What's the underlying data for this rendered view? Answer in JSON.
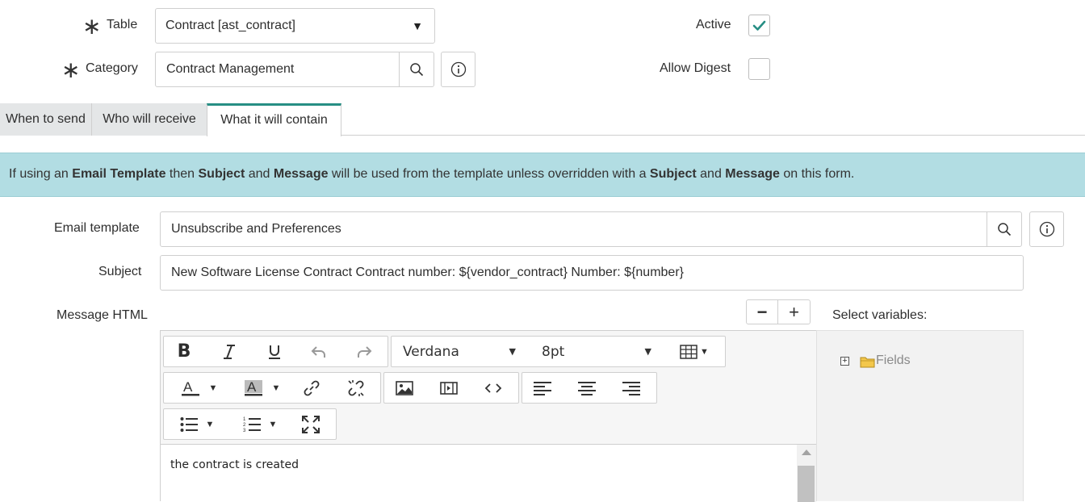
{
  "form": {
    "table": {
      "label": "Table",
      "value": "Contract [ast_contract]",
      "required_mark": "∗"
    },
    "category": {
      "label": "Category",
      "value": "Contract Management",
      "required_mark": "∗"
    },
    "active": {
      "label": "Active",
      "checked": true
    },
    "allow_digest": {
      "label": "Allow Digest",
      "checked": false
    }
  },
  "tabs": [
    {
      "label": "When to send",
      "active": false
    },
    {
      "label": "Who will receive",
      "active": false
    },
    {
      "label": "What it will contain",
      "active": true
    }
  ],
  "banner": {
    "parts": [
      "If using an ",
      "Email Template",
      " then ",
      "Subject",
      " and ",
      "Message",
      " will be used from the template unless overridden with a ",
      "Subject",
      " and ",
      "Message",
      " on this form."
    ]
  },
  "email_template": {
    "label": "Email template",
    "value": "Unsubscribe and Preferences"
  },
  "subject": {
    "label": "Subject",
    "value": "New Software License Contract Contract number: ${vendor_contract} Number: ${number}"
  },
  "message_html": {
    "label": "Message HTML",
    "zoom_out": "−",
    "zoom_in": "+",
    "font_family": "Verdana",
    "font_size": "8pt",
    "content": "the contract is created"
  },
  "variables": {
    "label": "Select variables:",
    "tree_root": "Fields",
    "expand_symbol": "+"
  },
  "colors": {
    "accent": "#278e84",
    "banner_bg": "#b2dde3",
    "tab_inactive": "#e4e6e7"
  }
}
